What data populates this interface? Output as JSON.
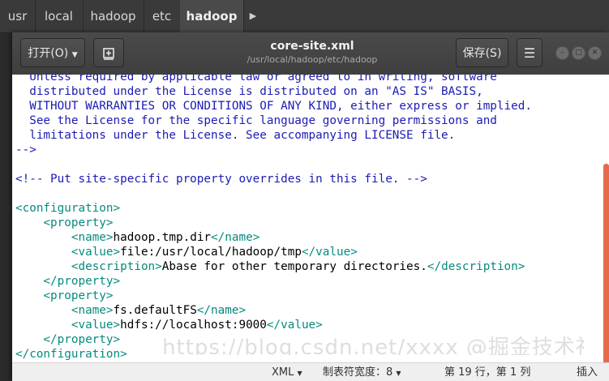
{
  "pathbar": {
    "crumbs": [
      "usr",
      "local",
      "hadoop",
      "etc",
      "hadoop"
    ],
    "more_icon": "chevron-right-icon"
  },
  "window": {
    "open_label": "打开(O)",
    "title": "core-site.xml",
    "subtitle": "/usr/local/hadoop/etc/hadoop",
    "save_label": "保存(S)",
    "menu_icon": "hamburger-menu-icon"
  },
  "editor": {
    "lines": [
      "  Unless required by applicable law or agreed to in writing, software",
      "  distributed under the License is distributed on an \"AS IS\" BASIS,",
      "  WITHOUT WARRANTIES OR CONDITIONS OF ANY KIND, either express or implied.",
      "  See the License for the specific language governing permissions and",
      "  limitations under the License. See accompanying LICENSE file.",
      "-->",
      "",
      "<!-- Put site-specific property overrides in this file. -->",
      "",
      "<configuration>",
      "    <property>",
      "        <name>hadoop.tmp.dir</name>",
      "        <value>file:/usr/local/hadoop/tmp</value>",
      "        <description>Abase for other temporary directories.</description>",
      "    </property>",
      "    <property>",
      "        <name>fs.defaultFS</name>",
      "        <value>hdfs://localhost:9000</value>",
      "    </property>",
      "</configuration>"
    ]
  },
  "statusbar": {
    "language": "XML",
    "tab_width": "制表符宽度：8",
    "position": "第 19 行，第 1 列",
    "mode": "插入"
  },
  "watermark": "https://blog.csdn.net/xxxx @掘金技术社区",
  "colors": {
    "comment": "#1b1bb4",
    "tag": "#068a7e",
    "headerbar": "#444444",
    "scrollbar": "#e7694b"
  }
}
